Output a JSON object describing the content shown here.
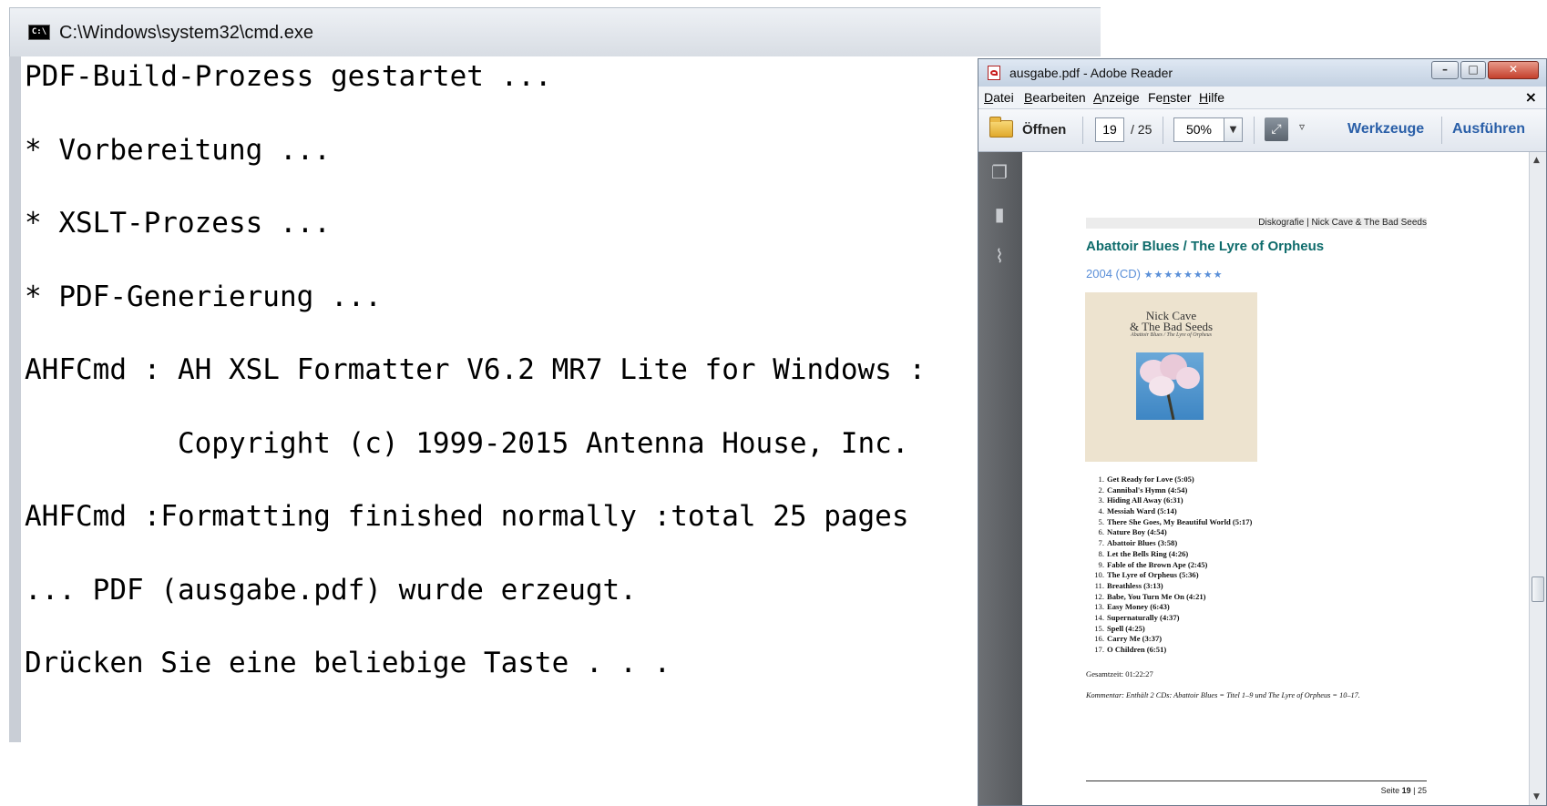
{
  "cmd": {
    "title": "C:\\Windows\\system32\\cmd.exe",
    "icon_text": "C:\\",
    "lines": [
      "PDF-Build-Prozess gestartet ...",
      "* Vorbereitung ...",
      "* XSLT-Prozess ...",
      "* PDF-Generierung ...",
      "AHFCmd : AH XSL Formatter V6.2 MR7 Lite for Windows :",
      "         Copyright (c) 1999-2015 Antenna House, Inc.",
      "AHFCmd :Formatting finished normally :total 25 pages",
      "... PDF (ausgabe.pdf) wurde erzeugt.",
      "Drücken Sie eine beliebige Taste . . ."
    ]
  },
  "reader": {
    "title": "ausgabe.pdf - Adobe Reader",
    "window_buttons": {
      "minimize": "–",
      "maximize": "□",
      "close": "✕"
    },
    "menu": [
      {
        "u": "D",
        "rest": "atei"
      },
      {
        "u": "B",
        "rest": "earbeiten"
      },
      {
        "u": "A",
        "rest": "nzeige"
      },
      {
        "pre": "Fe",
        "u": "n",
        "rest": "ster"
      },
      {
        "u": "H",
        "rest": "ilfe"
      }
    ],
    "menu_close": "×",
    "toolbar": {
      "open_label": "Öffnen",
      "current_page": "19",
      "total_pages": "/ 25",
      "zoom": "50%",
      "zoom_arrow": "▼",
      "fit_glyph": "⤢",
      "more_glyph": "▿",
      "tools_label": "Werkzeuge",
      "exec_label": "Ausführen"
    },
    "left_panel_icons": [
      "pages-icon",
      "bookmark-icon",
      "attachment-icon"
    ],
    "scroll": {
      "up": "▲",
      "down": "▼"
    },
    "page": {
      "header": "Diskografie | Nick Cave & The Bad Seeds",
      "album_title": "Abattoir Blues / The Lyre of Orpheus",
      "year_format": "2004 (CD)",
      "stars": "★★★★★★★★",
      "cover_artist_line1": "Nick Cave",
      "cover_artist_line2": "& The Bad Seeds",
      "cover_subtitle": "Abattoir Blues / The Lyre of Orpheus",
      "tracks": [
        {
          "no": "1.",
          "title": "Get Ready for Love (5:05)"
        },
        {
          "no": "2.",
          "title": "Cannibal's Hymn (4:54)"
        },
        {
          "no": "3.",
          "title": "Hiding All Away (6:31)"
        },
        {
          "no": "4.",
          "title": "Messiah Ward (5:14)"
        },
        {
          "no": "5.",
          "title": "There She Goes, My Beautiful World (5:17)"
        },
        {
          "no": "6.",
          "title": "Nature Boy (4:54)"
        },
        {
          "no": "7.",
          "title": "Abattoir Blues (3:58)"
        },
        {
          "no": "8.",
          "title": "Let the Bells Ring (4:26)"
        },
        {
          "no": "9.",
          "title": "Fable of the Brown Ape (2:45)"
        },
        {
          "no": "10.",
          "title": "The Lyre of Orpheus (5:36)"
        },
        {
          "no": "11.",
          "title": "Breathless (3:13)"
        },
        {
          "no": "12.",
          "title": "Babe, You Turn Me On (4:21)"
        },
        {
          "no": "13.",
          "title": "Easy Money (6:43)"
        },
        {
          "no": "14.",
          "title": "Supernaturally (4:37)"
        },
        {
          "no": "15.",
          "title": "Spell (4:25)"
        },
        {
          "no": "16.",
          "title": "Carry Me (3:37)"
        },
        {
          "no": "17.",
          "title": "O Children (6:51)"
        }
      ],
      "total_time": "Gesamtzeit: 01:22:27",
      "comment": "Kommentar: Enthält 2 CDs: Abattoir Blues = Titel 1–9 und The Lyre of Orpheus = 10–17.",
      "footer_prefix": "Seite ",
      "footer_page": "19",
      "footer_suffix": " | 25"
    }
  }
}
